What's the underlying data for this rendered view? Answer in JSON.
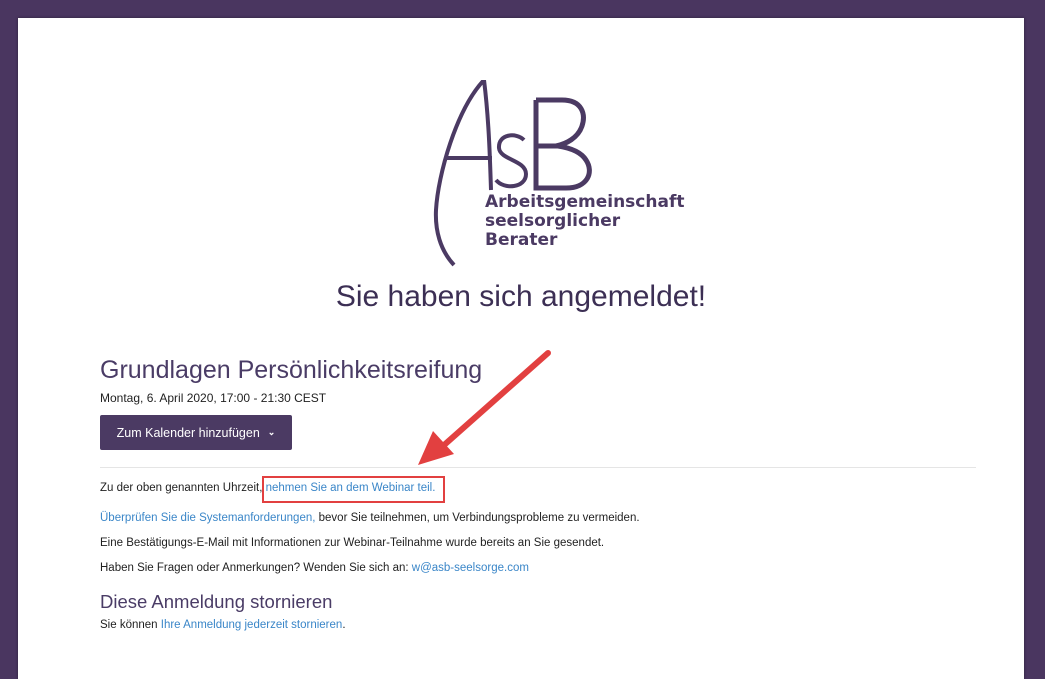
{
  "logo": {
    "mark": "AsB",
    "subtitle_lines": [
      "Arbeitsgemeinschaft",
      "seelsorglicher",
      "Berater"
    ]
  },
  "headline": "Sie haben sich angemeldet!",
  "event": {
    "title": "Grundlagen Persönlichkeitsreifung",
    "date": "Montag, 6. April 2020, 17:00 - 21:30 CEST",
    "calendar_button": "Zum Kalender hinzufügen"
  },
  "info": {
    "line1_prefix": "Zu der oben genannten Uhrzeit,",
    "line1_link": "nehmen Sie an dem Webinar teil.",
    "line2_link": "Überprüfen Sie die Systemanforderungen,",
    "line2_suffix": "bevor Sie teilnehmen, um Verbindungsprobleme zu vermeiden.",
    "line3": "Eine Bestätigungs-E-Mail mit Informationen zur Webinar-Teilnahme wurde bereits an Sie gesendet.",
    "line4_prefix": "Haben Sie Fragen oder Anmerkungen? Wenden Sie sich an:",
    "line4_link": "w@asb-seelsorge.com"
  },
  "cancel": {
    "title": "Diese Anmeldung stornieren",
    "prefix": "Sie können",
    "link": "Ihre Anmeldung jederzeit stornieren",
    "suffix": "."
  },
  "colors": {
    "background": "#4a3660",
    "brand_purple": "#4b3a63",
    "link": "#3a86c8",
    "annotation_red": "#e24040"
  },
  "icons": {
    "calendar_dropdown": "chevron-down-icon",
    "annotation": "red-arrow"
  }
}
